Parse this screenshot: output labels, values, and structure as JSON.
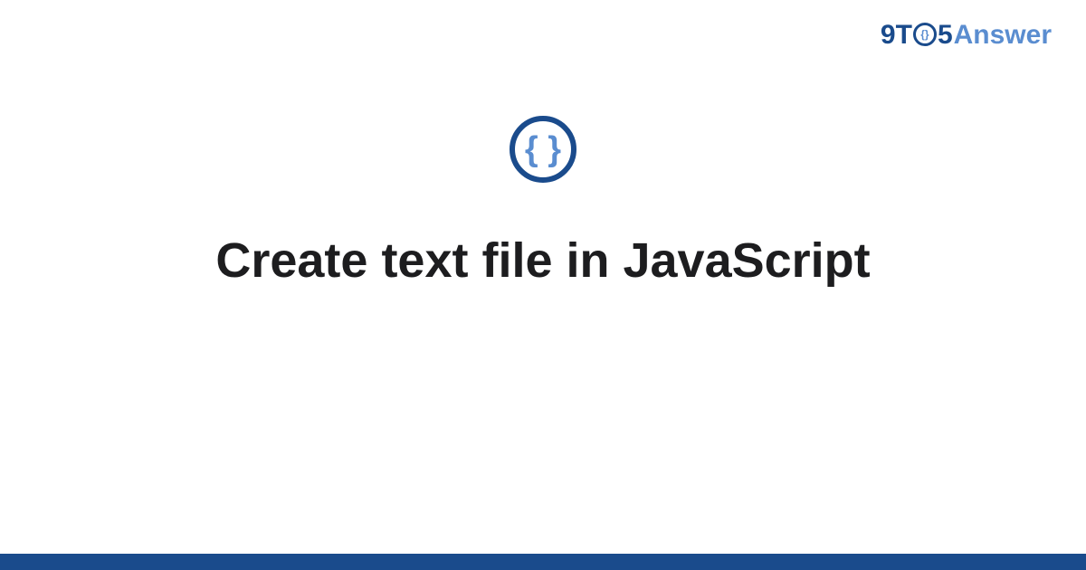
{
  "logo": {
    "part1": "9T",
    "circle_inner": "{}",
    "part2": "5",
    "part3": "Answer"
  },
  "icon": {
    "braces": "{ }"
  },
  "title": "Create text file in JavaScript",
  "colors": {
    "primary_dark": "#1a4b8c",
    "primary_light": "#5a8dd0",
    "text": "#1d1d1f"
  }
}
